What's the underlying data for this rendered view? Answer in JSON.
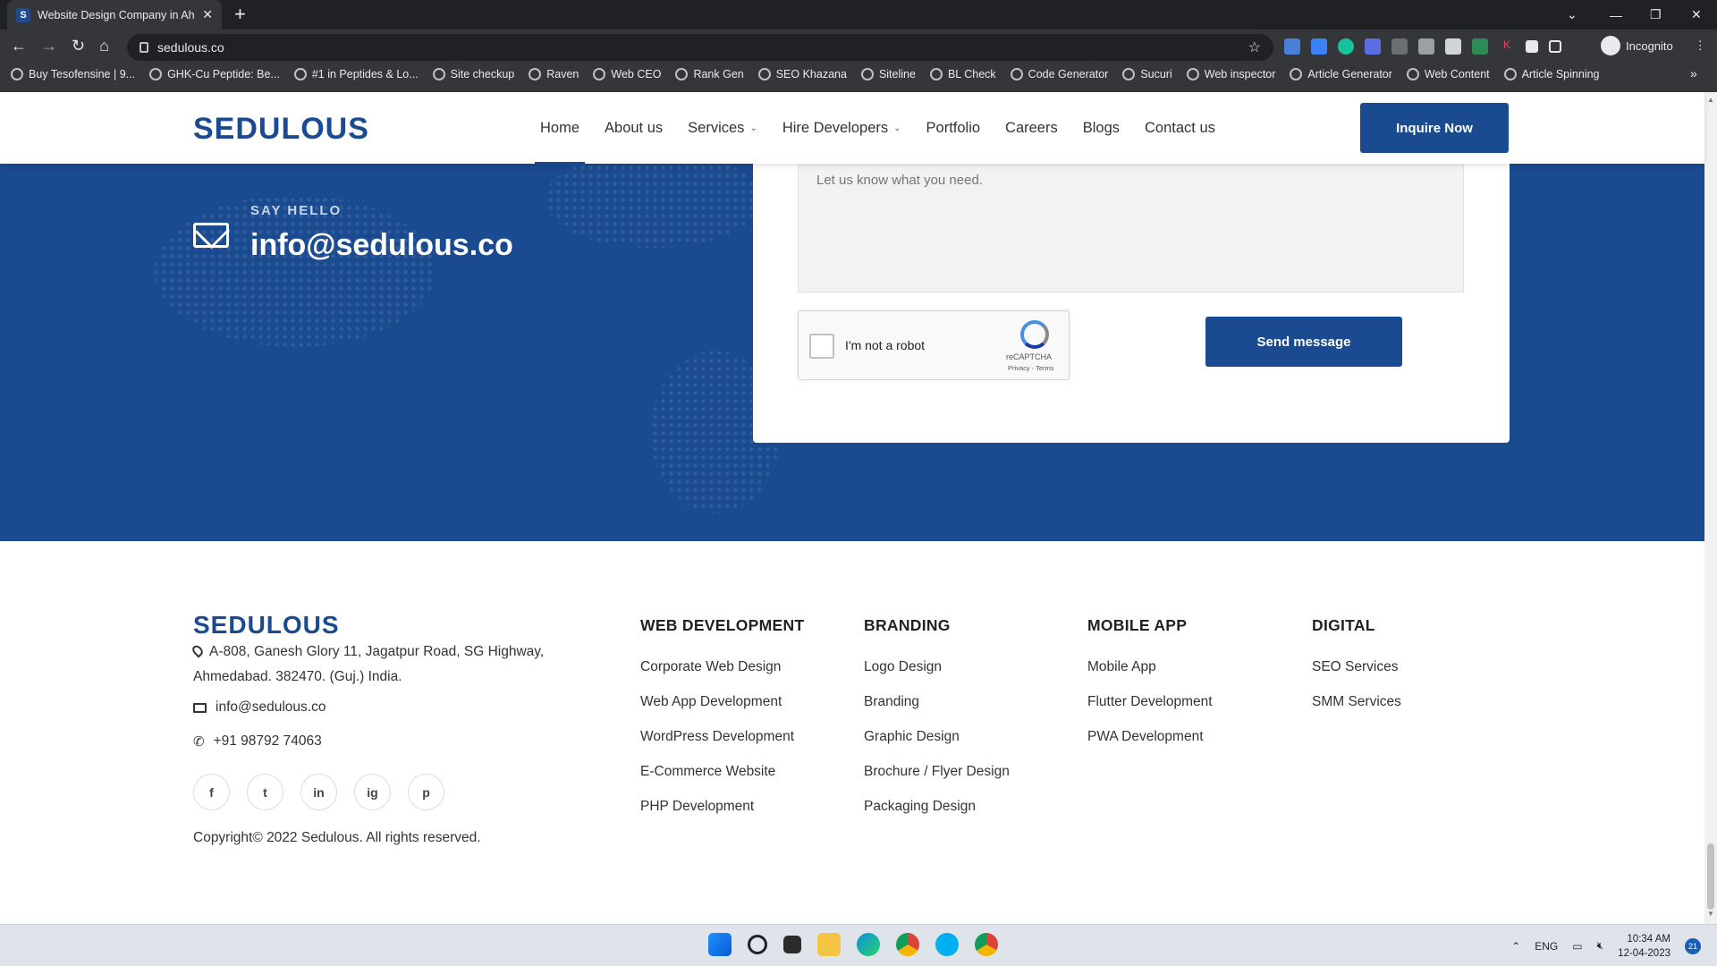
{
  "browser": {
    "tab_title": "Website Design Company in Ahm",
    "url": "sedulous.co",
    "profile_label": "Incognito",
    "bookmarks": [
      "Buy Tesofensine | 9...",
      "GHK-Cu Peptide: Be...",
      "#1 in Peptides & Lo...",
      "Site checkup",
      "Raven",
      "Web CEO",
      "Rank Gen",
      "SEO Khazana",
      "Siteline",
      "BL Check",
      "Code Generator",
      "Sucuri",
      "Web inspector",
      "Article Generator",
      "Web Content",
      "Article Spinning"
    ]
  },
  "header": {
    "logo": "SEDULOUS",
    "nav": [
      "Home",
      "About us",
      "Services",
      "Hire Developers",
      "Portfolio",
      "Careers",
      "Blogs",
      "Contact us"
    ],
    "inquire_label": "Inquire Now"
  },
  "contact": {
    "say_hello": "SAY HELLO",
    "email": "info@sedulous.co",
    "message_placeholder": "Let us know what you need.",
    "recaptcha_label": "I'm not a robot",
    "recaptcha_brand": "reCAPTCHA",
    "recaptcha_links": "Privacy - Terms",
    "send_label": "Send message"
  },
  "footer": {
    "logo": "SEDULOUS",
    "address": "A-808, Ganesh Glory 11, Jagatpur Road, SG Highway, Ahmedabad. 382470. (Guj.) India.",
    "email": "info@sedulous.co",
    "phone": "+91 98792 74063",
    "social": [
      "f",
      "t",
      "in",
      "ig",
      "p"
    ],
    "copyright": "Copyright© 2022 Sedulous. All rights reserved.",
    "columns": [
      {
        "title": "WEB DEVELOPMENT",
        "links": [
          "Corporate Web Design",
          "Web App Development",
          "WordPress Development",
          "E-Commerce Website",
          "PHP Development"
        ]
      },
      {
        "title": "BRANDING",
        "links": [
          "Logo Design",
          "Branding",
          "Graphic Design",
          "Brochure / Flyer Design",
          "Packaging Design"
        ]
      },
      {
        "title": "MOBILE APP",
        "links": [
          "Mobile App",
          "Flutter Development",
          "PWA Development"
        ]
      },
      {
        "title": "DIGITAL",
        "links": [
          "SEO Services",
          "SMM Services"
        ]
      }
    ]
  },
  "taskbar": {
    "lang": "ENG",
    "time": "10:34 AM",
    "date": "12-04-2023",
    "notifications": "21"
  },
  "colors": {
    "brand": "#1a4a8f"
  }
}
